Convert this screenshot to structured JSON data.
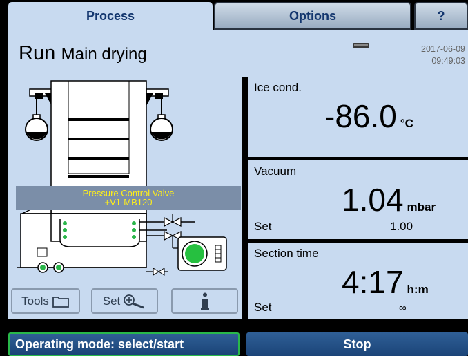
{
  "tabs": [
    {
      "label": "Process",
      "active": true
    },
    {
      "label": "Options",
      "active": false
    },
    {
      "label": "?",
      "active": false
    }
  ],
  "header": {
    "run_label": "Run",
    "phase": "Main drying",
    "date": "2017-06-09",
    "time": "09:49:03",
    "device_icon": "storage-drive-icon"
  },
  "schematic": {
    "valve_label_line1": "Pressure Control Valve",
    "valve_label_line2": "+V1-MB120"
  },
  "tools": {
    "tools_label": "Tools",
    "set_label": "Set",
    "info_icon": "info-icon"
  },
  "panels": {
    "ice_cond": {
      "label": "Ice cond.",
      "value": "-86.0",
      "unit": "°C"
    },
    "vacuum": {
      "label": "Vacuum",
      "value": "1.04",
      "unit": "mbar",
      "set_label": "Set",
      "set_value": "1.00"
    },
    "section_time": {
      "label": "Section time",
      "value": "4:17",
      "unit": "h:m",
      "set_label": "Set",
      "set_value": "∞"
    }
  },
  "bottom": {
    "mode_label": "Operating mode: select/start",
    "stop_label": "Stop"
  },
  "colors": {
    "panel_bg": "#c8daf0",
    "tab_text": "#13366e",
    "bottom_button": "#1f4a80",
    "active_border": "#29b84a",
    "valve_label_text": "#ffef1a"
  }
}
